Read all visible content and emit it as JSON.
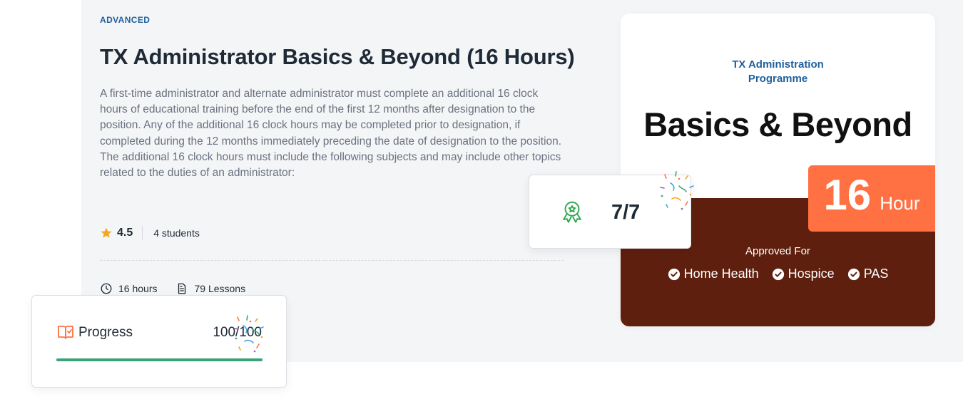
{
  "course": {
    "level": "ADVANCED",
    "title": "TX Administrator Basics & Beyond (16 Hours)",
    "description": "A first-time administrator and alternate administrator must complete an additional 16 clock hours of educational training before the end of the first 12 months after designation to the position. Any of the additional 16 clock hours may be completed prior to designation, if completed during the 12 months immediately preceding the date of designation to the position. The additional 16 clock hours must include the following subjects and may include other topics related to the duties of an administrator:",
    "rating": "4.5",
    "students": "4 students",
    "duration": "16 hours",
    "lessons": "79 Lessons"
  },
  "progress": {
    "label": "Progress",
    "count": "100/100",
    "fraction": 1.0
  },
  "lessons_card": {
    "value": "7/7"
  },
  "promo": {
    "kicker_line1": "TX Administration",
    "kicker_line2": "Programme",
    "heading": "Basics & Beyond",
    "hours_number": "16",
    "hours_unit": "Hour",
    "approved_title": "Approved For",
    "approved": [
      "Home Health",
      "Hospice",
      "PAS"
    ]
  },
  "colors": {
    "accent_blue": "#1f5f9c",
    "orange": "#ff7142",
    "maroon": "#5e1f0e",
    "progress_green": "#3aa37a",
    "star": "#f6a623"
  },
  "icons": {
    "star": "star-icon",
    "clock": "clock-icon",
    "lessons": "document-icon",
    "progress": "open-book-icon",
    "award": "award-badge-icon",
    "approved": "check-circle-icon"
  }
}
